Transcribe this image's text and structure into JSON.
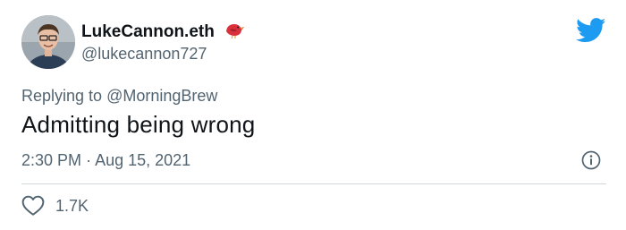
{
  "author": {
    "display_name": "LukeCannon.eth",
    "handle": "@lukecannon727",
    "badge_emoji": "bird-emoji"
  },
  "reply": {
    "prefix": "Replying to ",
    "mention": "@MorningBrew"
  },
  "tweet": {
    "text": "Admitting being wrong",
    "time": "2:30 PM",
    "separator": "·",
    "date": "Aug 15, 2021"
  },
  "engagement": {
    "likes": "1.7K"
  },
  "colors": {
    "twitter_blue": "#1d9bf0",
    "text_primary": "#0f1419",
    "text_secondary": "#536471",
    "divider": "#cfd9de"
  },
  "icons": {
    "brand": "twitter-bird-icon",
    "info": "info-icon",
    "like": "heart-icon"
  }
}
